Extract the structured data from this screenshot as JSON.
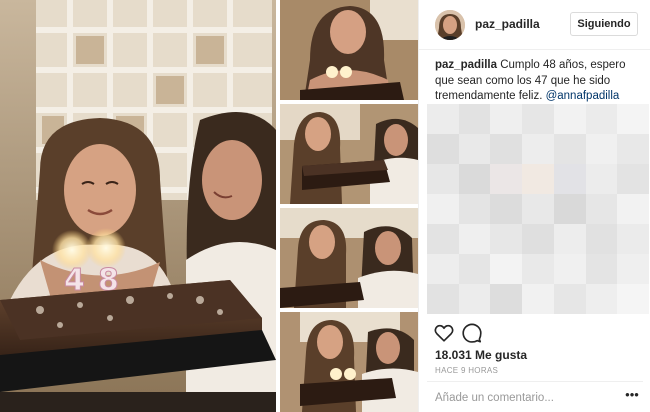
{
  "post": {
    "username": "paz_padilla",
    "follow_label": "Siguiendo",
    "caption": {
      "user": "paz_padilla",
      "text": " Cumplo 48 años, espero que sean como los 47 que he sido tremendamente feliz. ",
      "mention": "@annafpadilla"
    },
    "likes": "18.031 Me gusta",
    "time": "HACE 9 HORAS",
    "comment_placeholder": "Añade un comentario...",
    "more_label": "•••"
  },
  "icons": {
    "like": "heart-icon",
    "comment": "comment-icon",
    "more": "more-options-icon"
  },
  "colors": {
    "mention": "#003569",
    "text": "#262626",
    "muted": "#999999",
    "border": "#dbdbdb"
  },
  "photos": {
    "candle_digits": [
      "4",
      "8"
    ]
  }
}
